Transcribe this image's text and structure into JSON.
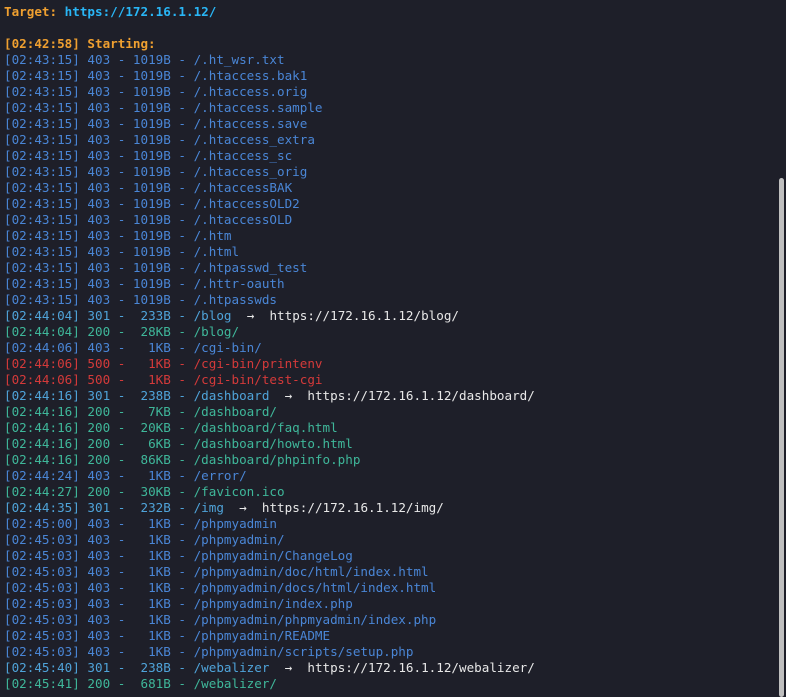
{
  "header": {
    "target_label": "Target:",
    "target_url": "https://172.16.1.12/",
    "starting": "[02:42:58] Starting:"
  },
  "colors": {
    "background": "#1e1f29",
    "status_403": "#4a86d6",
    "status_301": "#4fa3d9",
    "status_200": "#3fb79a",
    "status_500": "#d43a3a",
    "header_orange": "#f0a030",
    "header_url": "#29b6f6"
  },
  "separator": " - ",
  "arrow": "->",
  "results": [
    {
      "time": "[02:43:15]",
      "status": "403",
      "size": "1019B",
      "path": "/.ht_wsr.txt"
    },
    {
      "time": "[02:43:15]",
      "status": "403",
      "size": "1019B",
      "path": "/.htaccess.bak1"
    },
    {
      "time": "[02:43:15]",
      "status": "403",
      "size": "1019B",
      "path": "/.htaccess.orig"
    },
    {
      "time": "[02:43:15]",
      "status": "403",
      "size": "1019B",
      "path": "/.htaccess.sample"
    },
    {
      "time": "[02:43:15]",
      "status": "403",
      "size": "1019B",
      "path": "/.htaccess.save"
    },
    {
      "time": "[02:43:15]",
      "status": "403",
      "size": "1019B",
      "path": "/.htaccess_extra"
    },
    {
      "time": "[02:43:15]",
      "status": "403",
      "size": "1019B",
      "path": "/.htaccess_sc"
    },
    {
      "time": "[02:43:15]",
      "status": "403",
      "size": "1019B",
      "path": "/.htaccess_orig"
    },
    {
      "time": "[02:43:15]",
      "status": "403",
      "size": "1019B",
      "path": "/.htaccessBAK"
    },
    {
      "time": "[02:43:15]",
      "status": "403",
      "size": "1019B",
      "path": "/.htaccessOLD2"
    },
    {
      "time": "[02:43:15]",
      "status": "403",
      "size": "1019B",
      "path": "/.htaccessOLD"
    },
    {
      "time": "[02:43:15]",
      "status": "403",
      "size": "1019B",
      "path": "/.htm"
    },
    {
      "time": "[02:43:15]",
      "status": "403",
      "size": "1019B",
      "path": "/.html"
    },
    {
      "time": "[02:43:15]",
      "status": "403",
      "size": "1019B",
      "path": "/.htpasswd_test"
    },
    {
      "time": "[02:43:15]",
      "status": "403",
      "size": "1019B",
      "path": "/.httr-oauth"
    },
    {
      "time": "[02:43:15]",
      "status": "403",
      "size": "1019B",
      "path": "/.htpasswds"
    },
    {
      "time": "[02:44:04]",
      "status": "301",
      "size": "233B",
      "path": "/blog",
      "redirect": "https://172.16.1.12/blog/"
    },
    {
      "time": "[02:44:04]",
      "status": "200",
      "size": "28KB",
      "path": "/blog/"
    },
    {
      "time": "[02:44:06]",
      "status": "403",
      "size": "1KB",
      "path": "/cgi-bin/"
    },
    {
      "time": "[02:44:06]",
      "status": "500",
      "size": "1KB",
      "path": "/cgi-bin/printenv"
    },
    {
      "time": "[02:44:06]",
      "status": "500",
      "size": "1KB",
      "path": "/cgi-bin/test-cgi"
    },
    {
      "time": "[02:44:16]",
      "status": "301",
      "size": "238B",
      "path": "/dashboard",
      "redirect": "https://172.16.1.12/dashboard/"
    },
    {
      "time": "[02:44:16]",
      "status": "200",
      "size": "7KB",
      "path": "/dashboard/"
    },
    {
      "time": "[02:44:16]",
      "status": "200",
      "size": "20KB",
      "path": "/dashboard/faq.html"
    },
    {
      "time": "[02:44:16]",
      "status": "200",
      "size": "6KB",
      "path": "/dashboard/howto.html"
    },
    {
      "time": "[02:44:16]",
      "status": "200",
      "size": "86KB",
      "path": "/dashboard/phpinfo.php"
    },
    {
      "time": "[02:44:24]",
      "status": "403",
      "size": "1KB",
      "path": "/error/"
    },
    {
      "time": "[02:44:27]",
      "status": "200",
      "size": "30KB",
      "path": "/favicon.ico"
    },
    {
      "time": "[02:44:35]",
      "status": "301",
      "size": "232B",
      "path": "/img",
      "redirect": "https://172.16.1.12/img/"
    },
    {
      "time": "[02:45:00]",
      "status": "403",
      "size": "1KB",
      "path": "/phpmyadmin"
    },
    {
      "time": "[02:45:03]",
      "status": "403",
      "size": "1KB",
      "path": "/phpmyadmin/"
    },
    {
      "time": "[02:45:03]",
      "status": "403",
      "size": "1KB",
      "path": "/phpmyadmin/ChangeLog"
    },
    {
      "time": "[02:45:03]",
      "status": "403",
      "size": "1KB",
      "path": "/phpmyadmin/doc/html/index.html"
    },
    {
      "time": "[02:45:03]",
      "status": "403",
      "size": "1KB",
      "path": "/phpmyadmin/docs/html/index.html"
    },
    {
      "time": "[02:45:03]",
      "status": "403",
      "size": "1KB",
      "path": "/phpmyadmin/index.php"
    },
    {
      "time": "[02:45:03]",
      "status": "403",
      "size": "1KB",
      "path": "/phpmyadmin/phpmyadmin/index.php"
    },
    {
      "time": "[02:45:03]",
      "status": "403",
      "size": "1KB",
      "path": "/phpmyadmin/README"
    },
    {
      "time": "[02:45:03]",
      "status": "403",
      "size": "1KB",
      "path": "/phpmyadmin/scripts/setup.php"
    },
    {
      "time": "[02:45:40]",
      "status": "301",
      "size": "238B",
      "path": "/webalizer",
      "redirect": "https://172.16.1.12/webalizer/"
    },
    {
      "time": "[02:45:41]",
      "status": "200",
      "size": "681B",
      "path": "/webalizer/"
    }
  ]
}
